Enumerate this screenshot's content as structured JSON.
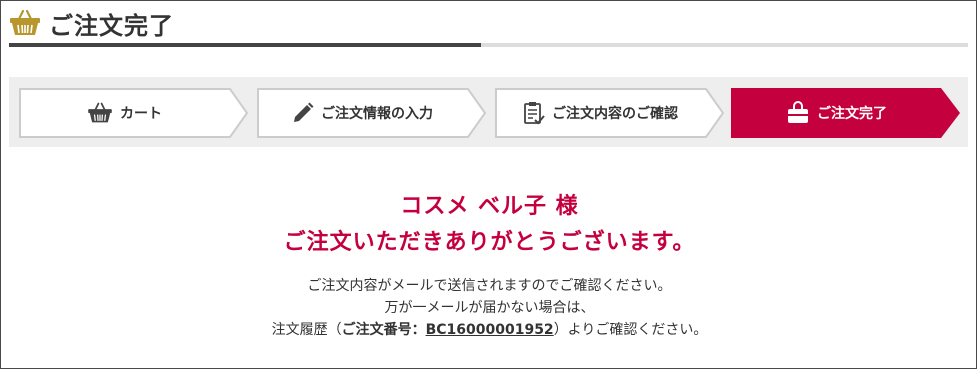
{
  "header": {
    "title": "ご注文完了"
  },
  "steps": [
    {
      "label": "カート",
      "icon": "basket-icon",
      "active": false
    },
    {
      "label": "ご注文情報の入力",
      "icon": "pencil-icon",
      "active": false
    },
    {
      "label": "ご注文内容のご確認",
      "icon": "checklist-icon",
      "active": false
    },
    {
      "label": "ご注文完了",
      "icon": "bag-icon",
      "active": true
    }
  ],
  "colors": {
    "accent": "#c4003f",
    "step_bg": "#eeeeee",
    "header_gold": "#b8962e"
  },
  "main": {
    "customer_name": "コスメ ベル子 様",
    "thanks": "ご注文いただきありがとうございます。",
    "line1": "ご注文内容がメールで送信されますのでご確認ください。",
    "line2": "万が一メールが届かない場合は、",
    "order_prefix": "注文履歴（",
    "order_label": "ご注文番号：",
    "order_number": "BC16000001952",
    "order_suffix": "）よりご確認ください。"
  }
}
